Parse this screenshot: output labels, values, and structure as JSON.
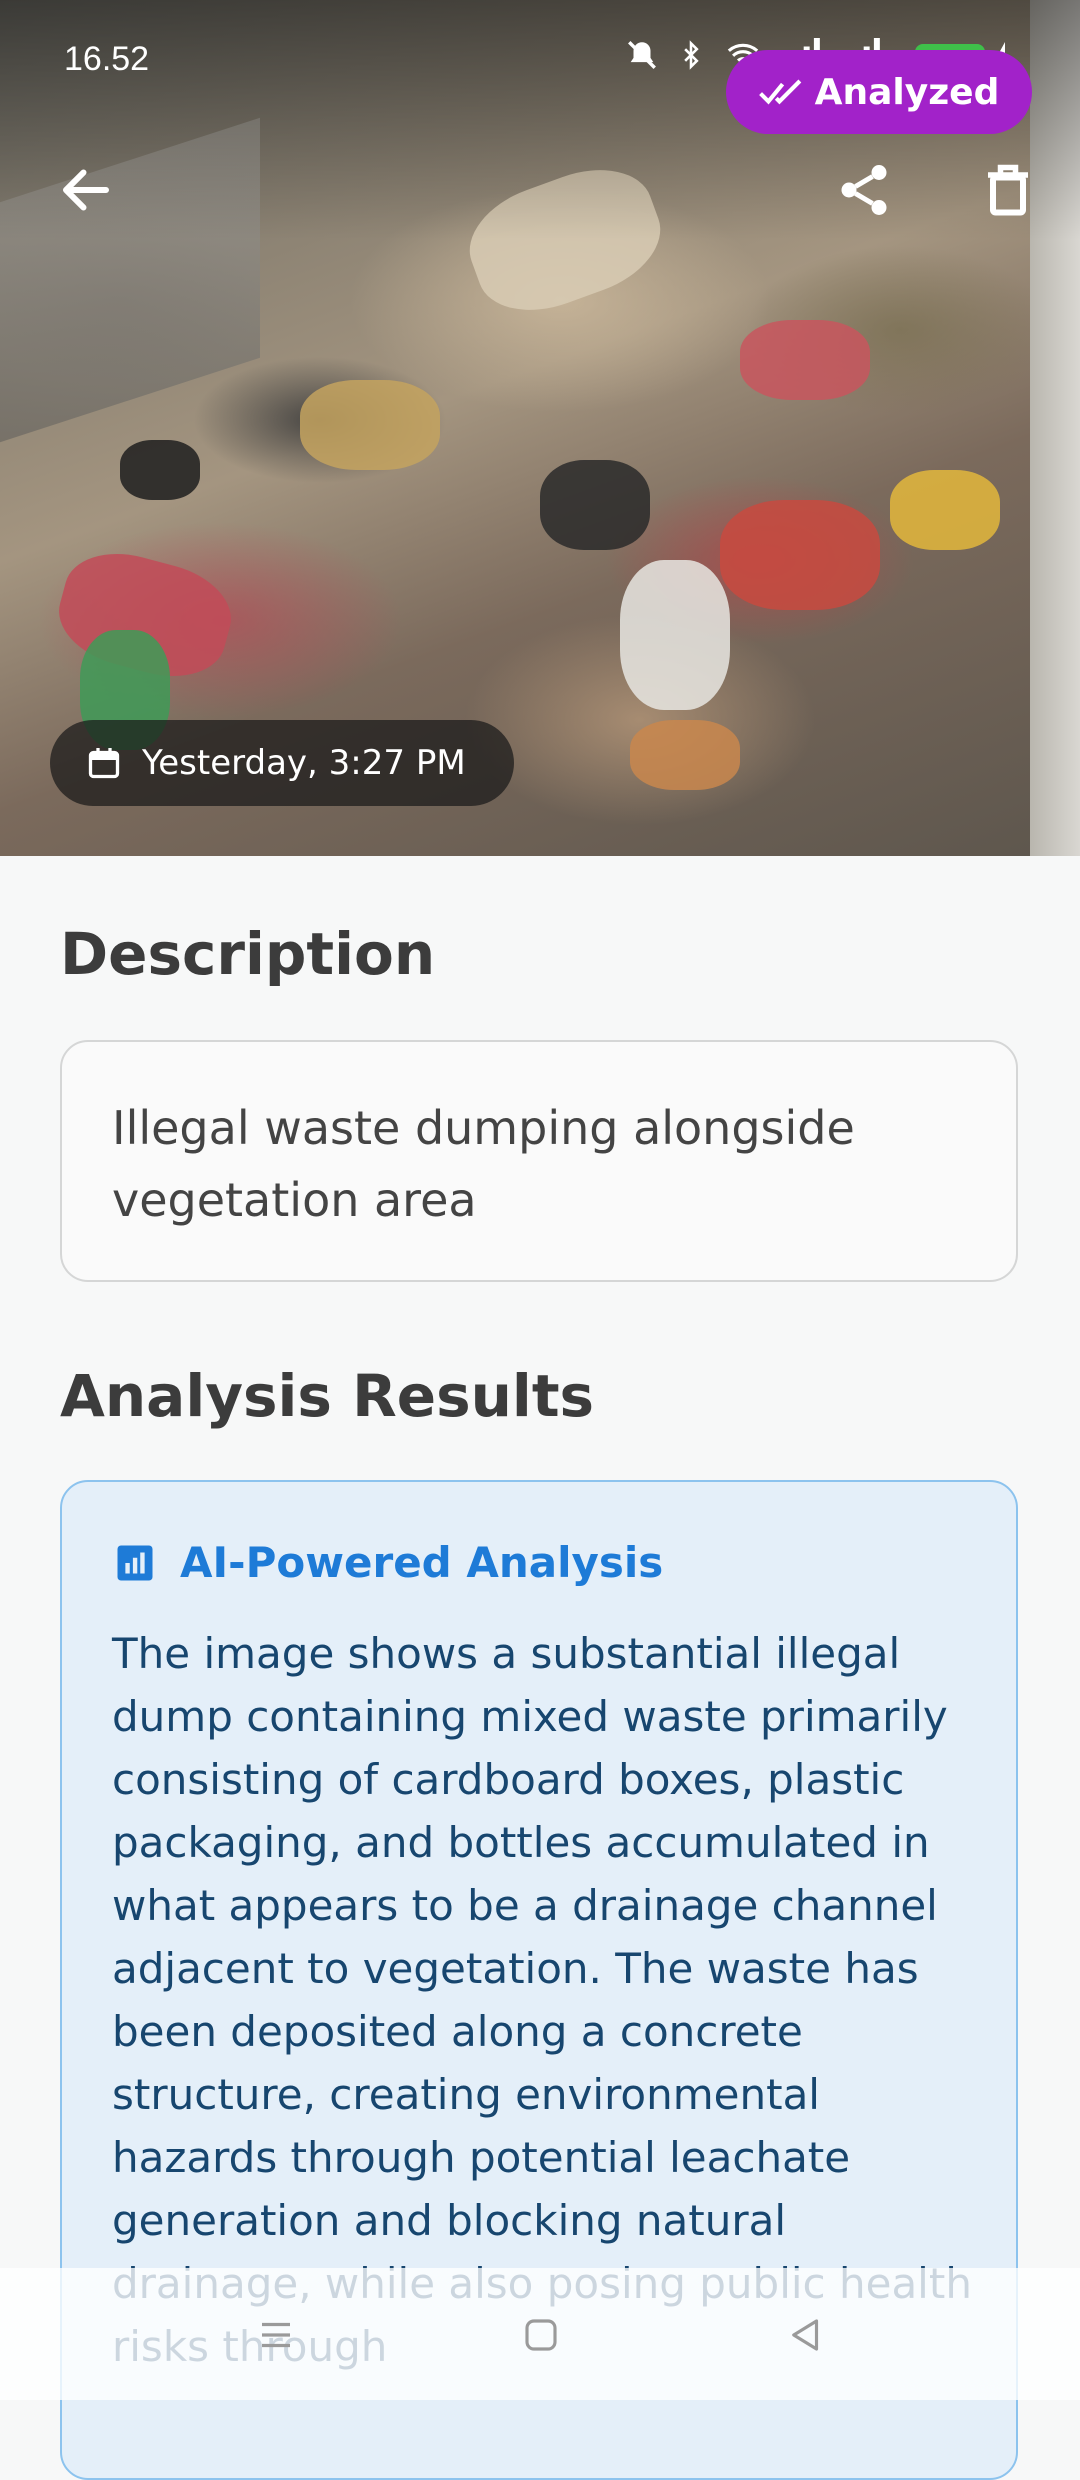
{
  "status_bar": {
    "time": "16.52",
    "battery": "60",
    "icons": [
      "mute-icon",
      "bluetooth-icon",
      "wifi-icon",
      "signal-icon",
      "signal-icon",
      "charging-icon"
    ]
  },
  "header": {
    "badge_label": "Analyzed",
    "badge_color": "#a222c9",
    "actions": [
      "back-arrow-icon",
      "share-icon",
      "trash-icon"
    ]
  },
  "photo": {
    "timestamp": "Yesterday, 3:27 PM"
  },
  "description": {
    "heading": "Description",
    "text": "Illegal waste dumping alongside vegetation area"
  },
  "analysis": {
    "heading": "Analysis Results",
    "card_title": "AI-Powered Analysis",
    "accent_color": "#1e7bd7",
    "text": "The image shows a substantial illegal dump containing mixed waste primarily consisting of cardboard boxes, plastic packaging, and bottles accumulated in what appears to be a drainage channel adjacent to vegetation. The waste has been deposited along a concrete structure, creating environmental hazards through potential leachate generation and blocking natural drainage, while also posing public health risks through"
  },
  "nav_bar": {
    "icons": [
      "menu-icon",
      "home-icon",
      "back-icon"
    ]
  }
}
